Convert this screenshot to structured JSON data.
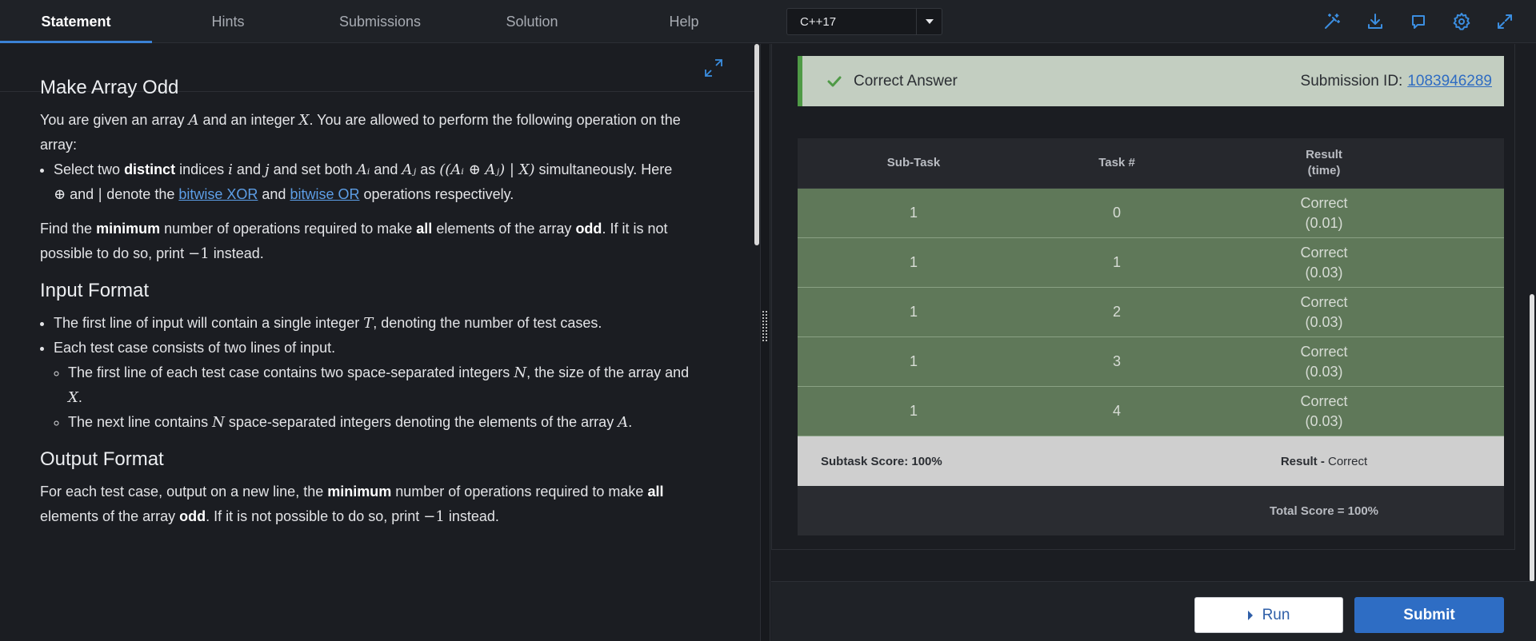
{
  "tabs": [
    {
      "label": "Statement",
      "active": true
    },
    {
      "label": "Hints",
      "active": false
    },
    {
      "label": "Submissions",
      "active": false
    },
    {
      "label": "Solution",
      "active": false
    },
    {
      "label": "Help",
      "active": false
    }
  ],
  "language": {
    "selected": "C++17"
  },
  "toolbar_icons": [
    "magic-wand-icon",
    "download-icon",
    "comment-icon",
    "gear-icon",
    "fullscreen-icon"
  ],
  "colors": {
    "accent": "#3b82d6",
    "success": "#4f9a46",
    "row_green": "#5f7859",
    "submit": "#2e6dc4"
  },
  "problem": {
    "title": "Make Array Odd",
    "intro_1": "You are given an array",
    "var_A": "A",
    "intro_2": "and an integer",
    "var_X": "X",
    "intro_3": ". You are allowed to perform the following operation on the array:",
    "op_1": "Select two",
    "op_distinct": "distinct",
    "op_2": "indices",
    "var_i": "i",
    "op_and": "and",
    "var_j": "j",
    "op_3": "and set both",
    "var_Ai": "Aᵢ",
    "var_Aj": "Aⱼ",
    "op_as": "as",
    "op_expr": "((Aᵢ ⊕ Aⱼ) | X)",
    "op_4": "simultaneously. Here",
    "sym_xor": "⊕",
    "op_and2": "and",
    "sym_or": "|",
    "op_5": "denote the",
    "link_xor": "bitwise XOR",
    "op_and3": "and",
    "link_or": "bitwise OR",
    "op_6": "operations respectively.",
    "find_1": "Find the",
    "find_min": "minimum",
    "find_2": "number of operations required to make",
    "find_all": "all",
    "find_3": "elements of the array",
    "find_odd": "odd",
    "find_4": ". If it is not possible to do so, print",
    "find_neg": "−1",
    "find_5": "instead.",
    "input_title": "Input Format",
    "in_1a": "The first line of input will contain a single integer",
    "var_T": "T",
    "in_1b": ", denoting the number of test cases.",
    "in_2": "Each test case consists of two lines of input.",
    "in_3a": "The first line of each test case contains two space-separated integers",
    "var_N": "N",
    "in_3b": ", the size of the array and",
    "var_X2": "X",
    "in_3c": ".",
    "in_4a": "The next line contains",
    "var_N2": "N",
    "in_4b": "space-separated integers denoting the elements of the array",
    "var_A2": "A",
    "in_4c": ".",
    "output_title": "Output Format",
    "out_1": "For each test case, output on a new line, the",
    "out_min": "minimum",
    "out_2": "number of operations required to make",
    "out_all": "all",
    "out_3": "elements of the array",
    "out_odd": "odd",
    "out_4": ". If it is not possible to do so, print",
    "out_neg": "−1",
    "out_5": "instead."
  },
  "verdict": {
    "status": "Correct Answer",
    "submission_label": "Submission ID:",
    "submission_id": "1083946289"
  },
  "results": {
    "headers": {
      "subtask": "Sub-Task",
      "task": "Task #",
      "result": "Result",
      "time": "(time)"
    },
    "rows": [
      {
        "subtask": "1",
        "task": "0",
        "result": "Correct",
        "time": "(0.01)"
      },
      {
        "subtask": "1",
        "task": "1",
        "result": "Correct",
        "time": "(0.03)"
      },
      {
        "subtask": "1",
        "task": "2",
        "result": "Correct",
        "time": "(0.03)"
      },
      {
        "subtask": "1",
        "task": "3",
        "result": "Correct",
        "time": "(0.03)"
      },
      {
        "subtask": "1",
        "task": "4",
        "result": "Correct",
        "time": "(0.03)"
      }
    ],
    "subtask_score": "Subtask Score: 100%",
    "result_label": "Result -",
    "result_value": "Correct",
    "total_score": "Total Score = 100%"
  },
  "actions": {
    "run": "Run",
    "submit": "Submit"
  }
}
